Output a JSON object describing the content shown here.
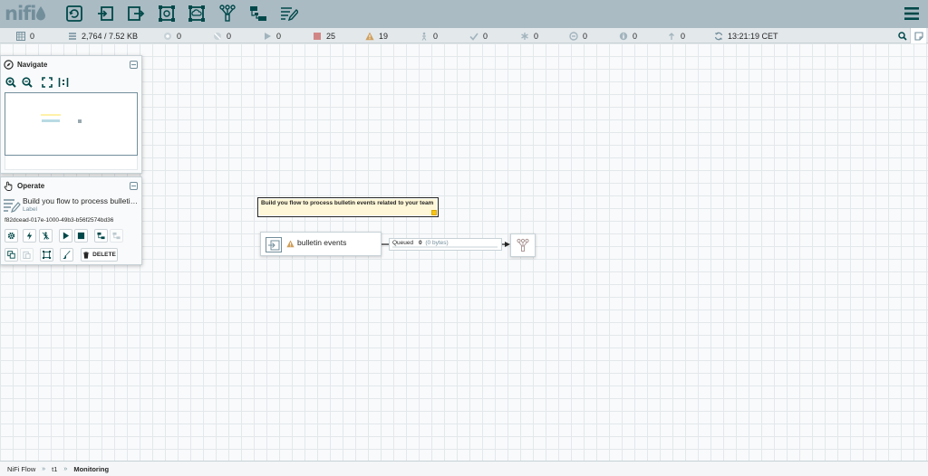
{
  "app": {
    "logo_text": "nifi"
  },
  "toolbar": {
    "components": [
      {
        "name": "processor",
        "icon": "processor-icon"
      },
      {
        "name": "input-port",
        "icon": "input-port-icon"
      },
      {
        "name": "output-port",
        "icon": "output-port-icon"
      },
      {
        "name": "process-group",
        "icon": "process-group-icon"
      },
      {
        "name": "remote-process-group",
        "icon": "remote-process-group-icon"
      },
      {
        "name": "funnel",
        "icon": "funnel-icon"
      },
      {
        "name": "template",
        "icon": "template-icon"
      },
      {
        "name": "label",
        "icon": "label-icon"
      }
    ],
    "menu_icon": "hamburger-menu-icon"
  },
  "status": {
    "active_threads": "0",
    "queued": "2,764 / 7.52 KB",
    "transmitting": "0",
    "not_transmitting": "0",
    "running": "0",
    "stopped": "25",
    "invalid": "19",
    "disabled": "0",
    "up_to_date": "0",
    "locally_modified": "0",
    "stale": "0",
    "locally_modified_stale": "0",
    "sync_failure": "0",
    "last_refreshed": "13:21:19 CET"
  },
  "navigate": {
    "title": "Navigate"
  },
  "operate": {
    "title": "Operate",
    "selection_name": "Build you flow to process bulletin events related to your team",
    "selection_type": "Label",
    "selection_id": "f82dcead-017e-1000-49b3-b56f2574bd36",
    "delete_label": "DELETE"
  },
  "canvas": {
    "label_text": "Build you flow to process bulletin events related to your team",
    "port_name": "bulletin events",
    "connection_queued_label": "Queued",
    "connection_queued_count": "0",
    "connection_queued_size": "(0 bytes)"
  },
  "breadcrumbs": [
    {
      "label": "NiFi Flow"
    },
    {
      "label": "t1"
    },
    {
      "label": "Monitoring"
    }
  ],
  "colors": {
    "header": "#aabbc3",
    "accent": "#004849",
    "stopped": "#d18686",
    "invalid": "#cf9f5d",
    "label_bg": "#fff7d7"
  }
}
